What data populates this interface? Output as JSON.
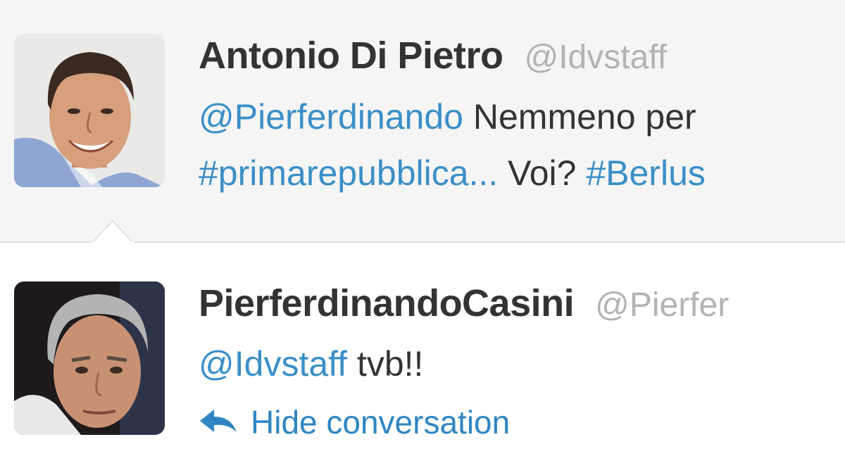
{
  "tweets": [
    {
      "fullname": "Antonio Di Pietro",
      "screen_name": "@Idvstaff",
      "line1": {
        "mention": "@Pierferdinando",
        "text": " Nemmeno per"
      },
      "line2": {
        "hashtag1": "#primarepubblica...",
        "text": " Voi? ",
        "hashtag2": "#Berlus"
      },
      "avatar_icon": "avatar-portrait-icon"
    },
    {
      "fullname": "PierferdinandoCasini",
      "screen_name": "@Pierfer",
      "line1": {
        "mention": "@Idvstaff",
        "text": " tvb!!"
      },
      "action": {
        "icon": "reply-arrow-icon",
        "label": "Hide conversation"
      },
      "avatar_icon": "avatar-portrait-icon"
    }
  ],
  "colors": {
    "link": "#3a8fc7",
    "name": "#333333",
    "screen_name": "#b3b3b3",
    "context_background": "#f5f5f5"
  }
}
